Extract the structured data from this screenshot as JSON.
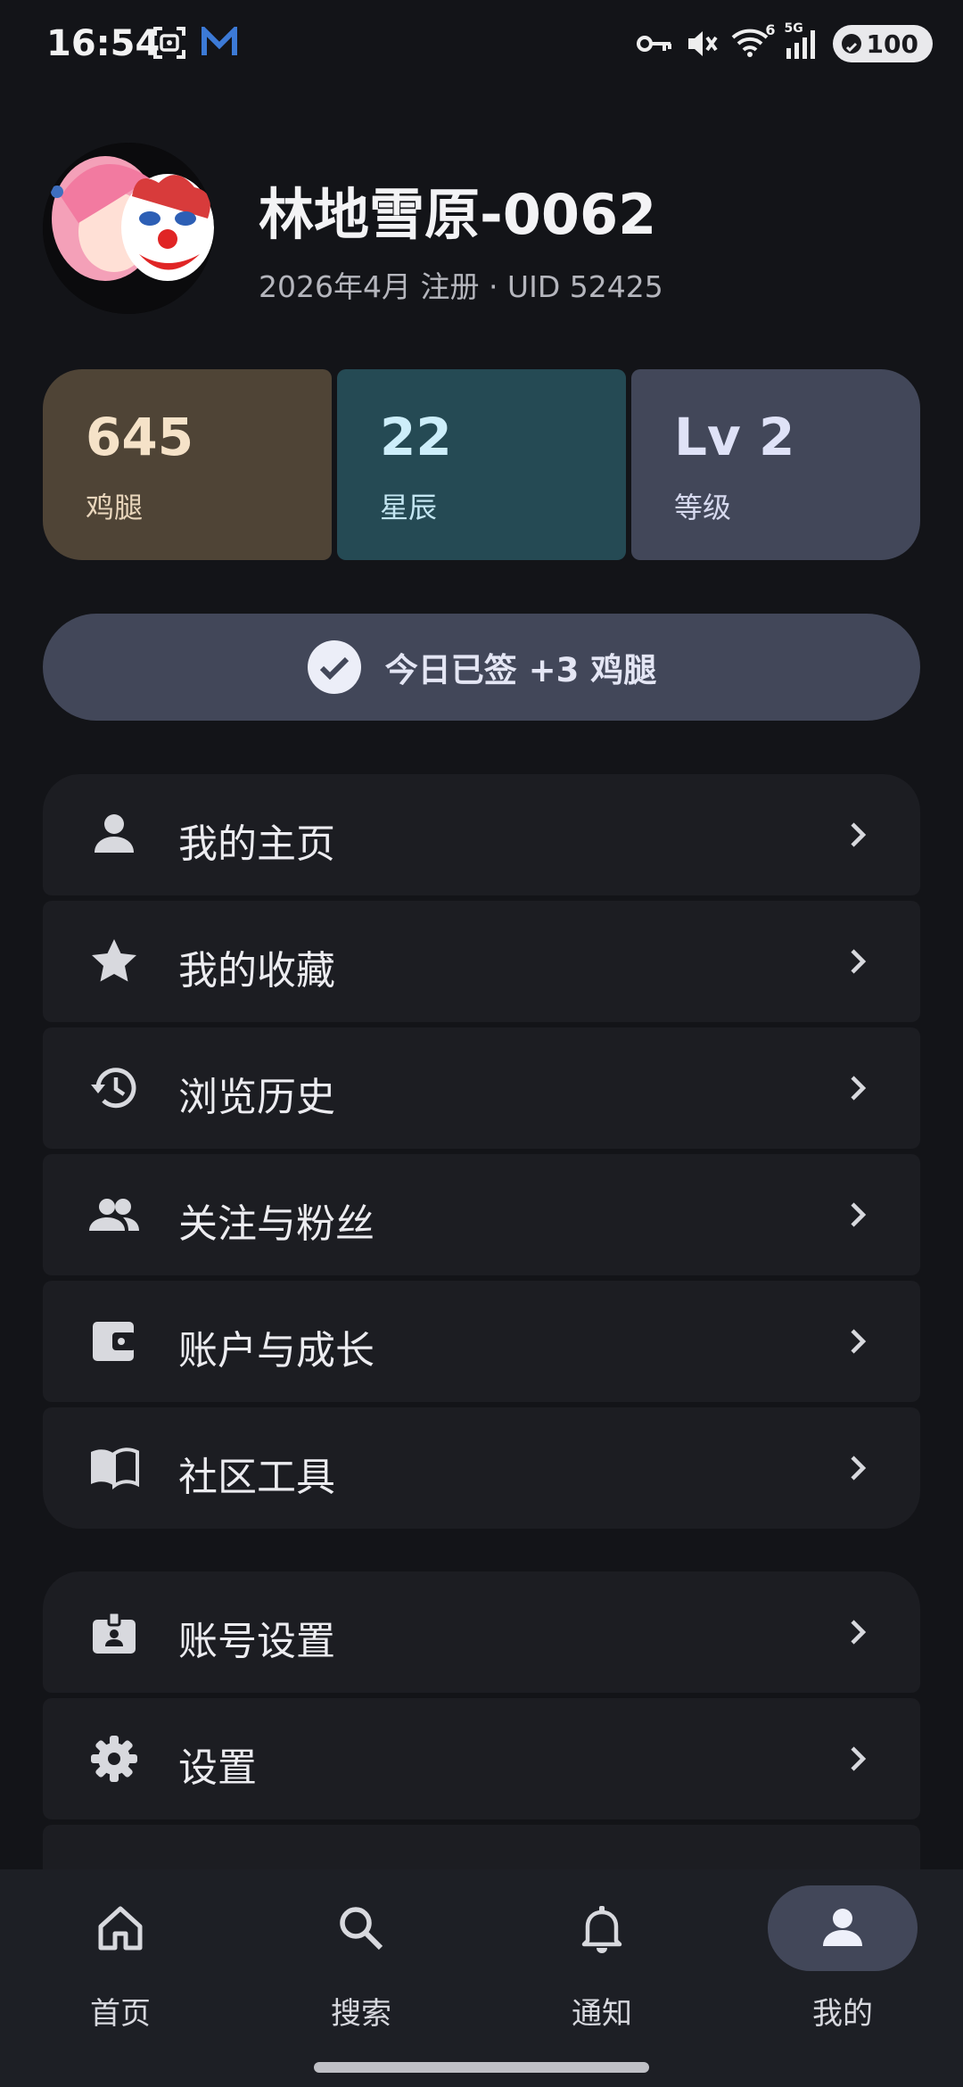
{
  "status_bar": {
    "time": "16:54",
    "battery": "100",
    "signal_label": "5G",
    "wifi_label": "6",
    "icons": [
      "screenshot-icon",
      "m-app-icon",
      "key-icon",
      "mute-icon",
      "wifi-icon",
      "signal-icon",
      "battery-icon"
    ]
  },
  "profile": {
    "name": "林地雪原-0062",
    "meta": "2026年4月 注册 · UID 52425"
  },
  "stats": [
    {
      "value": "645",
      "label": "鸡腿",
      "color": "#4f4436"
    },
    {
      "value": "22",
      "label": "星辰",
      "color": "#254a54"
    },
    {
      "value": "Lv 2",
      "label": "等级",
      "color": "#424759"
    }
  ],
  "checkin": {
    "label": "今日已签 +3 鸡腿"
  },
  "menu_group_1": [
    {
      "label": "我的主页",
      "icon": "person-icon"
    },
    {
      "label": "我的收藏",
      "icon": "star-icon"
    },
    {
      "label": "浏览历史",
      "icon": "history-icon"
    },
    {
      "label": "关注与粉丝",
      "icon": "people-icon"
    },
    {
      "label": "账户与成长",
      "icon": "wallet-icon"
    },
    {
      "label": "社区工具",
      "icon": "book-icon"
    }
  ],
  "menu_group_2": [
    {
      "label": "账号设置",
      "icon": "badge-icon"
    },
    {
      "label": "设置",
      "icon": "gear-icon"
    }
  ],
  "nav": [
    {
      "label": "首页",
      "icon": "home-icon"
    },
    {
      "label": "搜索",
      "icon": "search-icon"
    },
    {
      "label": "通知",
      "icon": "bell-icon"
    },
    {
      "label": "我的",
      "icon": "person-icon",
      "active": true
    }
  ]
}
